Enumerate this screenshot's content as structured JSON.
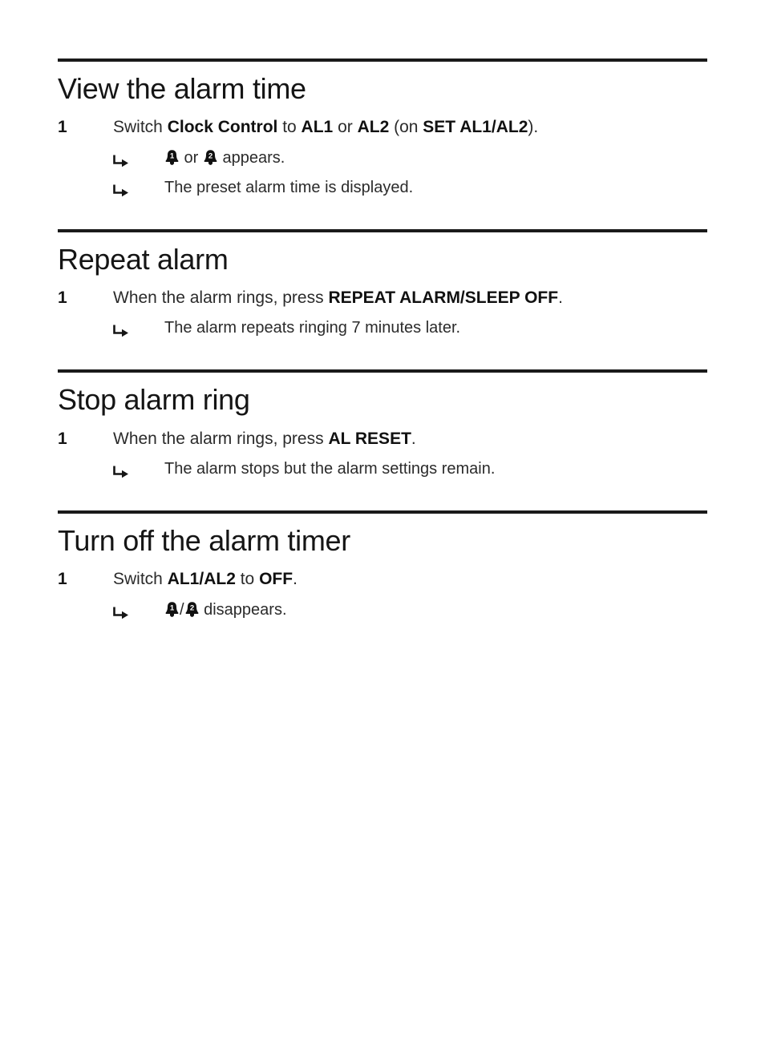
{
  "page": {
    "background": "#ffffff",
    "text_color": "#2b2b2b",
    "rule_color": "#1a1a1a"
  },
  "sections": [
    {
      "id": "view-the-alarm-time",
      "heading": "View the alarm time",
      "step_number": "1",
      "step_text_parts": [
        {
          "text": "Switch ",
          "bold": false
        },
        {
          "text": "Clock Control",
          "bold": true
        },
        {
          "text": " to ",
          "bold": false
        },
        {
          "text": "AL1",
          "bold": true
        },
        {
          "text": " or ",
          "bold": false
        },
        {
          "text": "AL2",
          "bold": true
        },
        {
          "text": " (on ",
          "bold": false
        },
        {
          "text": "SET AL1/AL2",
          "bold": true
        },
        {
          "text": ").",
          "bold": false
        }
      ],
      "step_text_plain": "Switch Clock Control to AL1 or AL2 (on SET AL1/AL2).",
      "results": [
        {
          "icons": [
            "bell-1-icon",
            "bell-2-icon"
          ],
          "icon_separator": " or ",
          "text_after_icons": " appears.",
          "text_plain": "\u0001 or \u0002 appears."
        },
        {
          "icons": [],
          "icon_separator": "",
          "text_after_icons": "The preset alarm time is displayed.",
          "text_plain": "The preset alarm time is displayed."
        }
      ]
    },
    {
      "id": "repeat-alarm",
      "heading": "Repeat alarm",
      "step_number": "1",
      "step_text_parts": [
        {
          "text": "When the alarm rings, press ",
          "bold": false
        },
        {
          "text": "REPEAT ALARM/SLEEP OFF",
          "bold": true
        },
        {
          "text": ".",
          "bold": false
        }
      ],
      "step_text_plain": "When the alarm rings, press REPEAT ALARM/SLEEP OFF.",
      "results": [
        {
          "icons": [],
          "icon_separator": "",
          "text_after_icons": "The alarm repeats ringing 7 minutes later.",
          "text_plain": "The alarm repeats ringing 7 minutes later."
        }
      ]
    },
    {
      "id": "stop-alarm-ring",
      "heading": "Stop alarm ring",
      "step_number": "1",
      "step_text_parts": [
        {
          "text": "When the alarm rings, press ",
          "bold": false
        },
        {
          "text": "AL RESET",
          "bold": true
        },
        {
          "text": ".",
          "bold": false
        }
      ],
      "step_text_plain": "When the alarm rings, press AL RESET.",
      "results": [
        {
          "icons": [],
          "icon_separator": "",
          "text_after_icons": "The alarm stops but the alarm settings remain.",
          "text_plain": "The alarm stops but the alarm settings remain."
        }
      ]
    },
    {
      "id": "turn-off-the-alarm-timer",
      "heading": "Turn off the alarm timer",
      "step_number": "1",
      "step_text_parts": [
        {
          "text": "Switch ",
          "bold": false
        },
        {
          "text": "AL1/AL2",
          "bold": true
        },
        {
          "text": " to ",
          "bold": false
        },
        {
          "text": "OFF",
          "bold": true
        },
        {
          "text": ".",
          "bold": false
        }
      ],
      "step_text_plain": "Switch AL1/AL2 to OFF.",
      "results": [
        {
          "icons": [
            "bell-1-icon",
            "bell-2-icon"
          ],
          "icon_separator": "/",
          "text_after_icons": " disappears.",
          "text_plain": "\u0001/\u0002 disappears."
        }
      ]
    }
  ],
  "icons": {
    "arrow_result_icon": "↳",
    "bell_1_label": "1",
    "bell_2_label": "2"
  }
}
